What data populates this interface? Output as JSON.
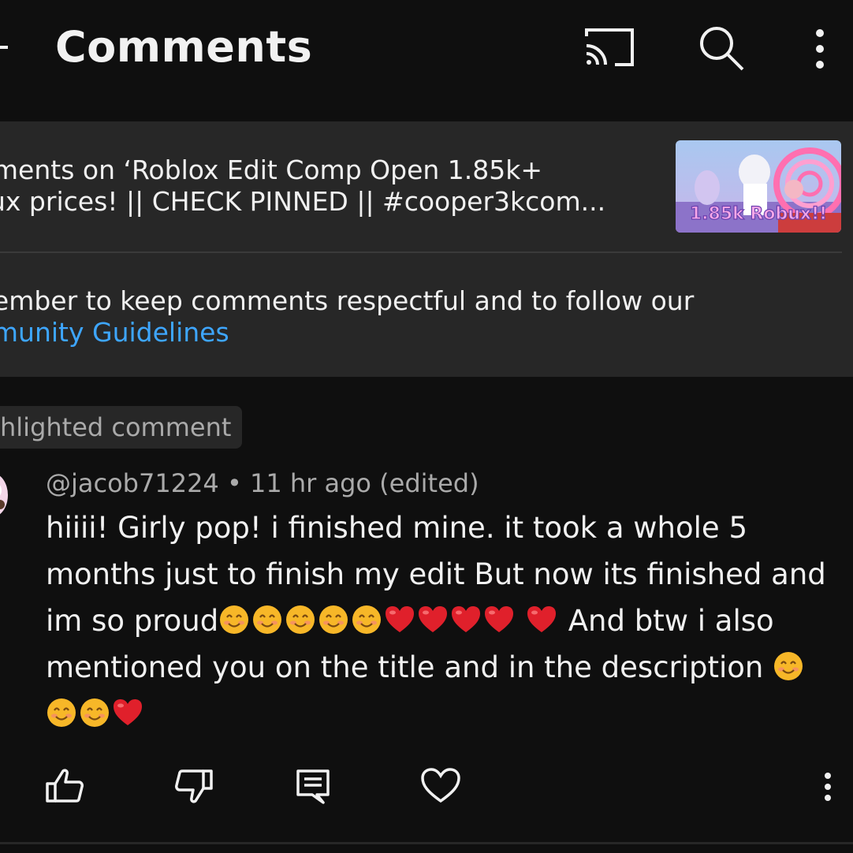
{
  "header": {
    "title": "Comments",
    "icons": [
      "back-arrow-icon",
      "cast-icon",
      "search-icon",
      "more-vert-icon"
    ]
  },
  "video": {
    "title_line1": "nments on ‘Roblox Edit Comp Open 1.85k+",
    "title_line2": "ux prices! || CHECK PINNED || #cooper3kcom...",
    "thumbnail_caption": "1.85k Robux!!"
  },
  "guidelines": {
    "line1": "nember to keep comments respectful and to follow our",
    "link": "nmunity Guidelines"
  },
  "highlight_chip": "hlighted comment",
  "comment": {
    "author": "@jacob71224",
    "separator": "•",
    "time": "11 hr ago",
    "edited": "(edited)",
    "seg1": "hiiii! Girly pop! i finished mine. it took a whole 5 months just to finish my edit But now its finished and im so proud",
    "seg2": " And btw i also mentioned you on the title and in the description ",
    "emojis": [
      "smiling-face-emoji",
      "red-heart-emoji"
    ]
  },
  "actions": [
    "like-icon",
    "dislike-icon",
    "reply-icon",
    "heart-icon",
    "more-vert-icon"
  ],
  "colors": {
    "background": "#0f0f0f",
    "panel": "#272727",
    "text": "#f1f1f1",
    "secondary_text": "#aaaaaa",
    "link": "#3ea6ff",
    "heart": "#e0202b",
    "smile": "#f7b728"
  }
}
